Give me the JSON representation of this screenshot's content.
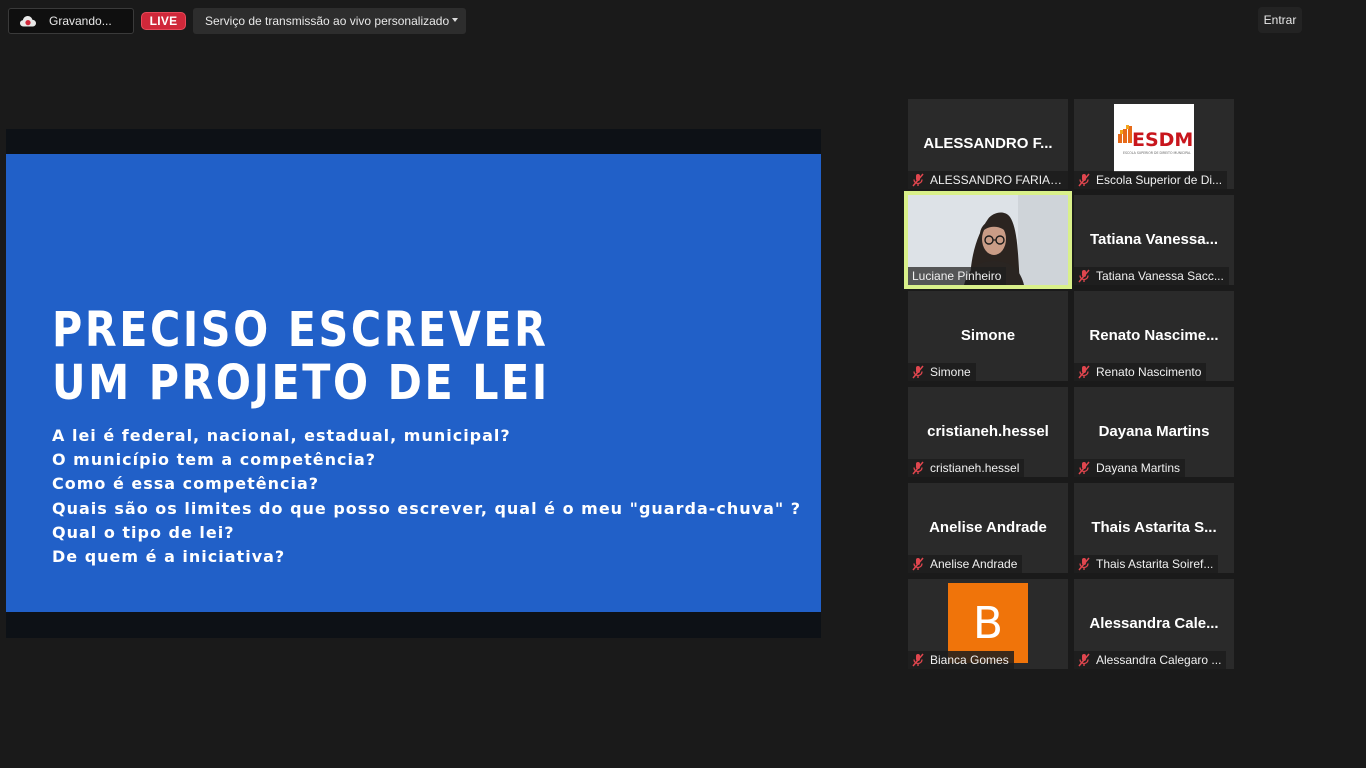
{
  "topbar": {
    "recording_label": "Gravando...",
    "live_label": "LIVE",
    "stream_service_label": "Serviço de transmissão ao vivo personalizado",
    "enter_label": "Entrar"
  },
  "shared_slide": {
    "title_line1": "PRECISO ESCREVER",
    "title_line2": "UM PROJETO DE LEI",
    "questions": [
      "A lei é federal, nacional, estadual, municipal?",
      "O município tem a competência?",
      "Como é essa competência?",
      "Quais são os limites do que posso escrever, qual é o meu \"guarda-chuva\" ?",
      "Qual o tipo de lei?",
      "De quem é a iniciativa?"
    ],
    "background_color": "#2160c8"
  },
  "gallery": [
    {
      "display": "ALESSANDRO F...",
      "name": "ALESSANDRO FARIAS...",
      "muted": true
    },
    {
      "display": "",
      "name": "Escola Superior de Di...",
      "muted": true,
      "logo_text": "ESDM",
      "logo_subtext": "Escola Superior de Direito Municipal"
    },
    {
      "display": "",
      "name": "Luciane Pinheiro",
      "muted": false,
      "active_speaker": true
    },
    {
      "display": "Tatiana  Vanessa...",
      "name": "Tatiana Vanessa Sacc...",
      "muted": true
    },
    {
      "display": "Simone",
      "name": "Simone",
      "muted": true
    },
    {
      "display": "Renato  Nascime...",
      "name": "Renato Nascimento",
      "muted": true
    },
    {
      "display": "cristianeh.hessel",
      "name": "cristianeh.hessel",
      "muted": true
    },
    {
      "display": "Dayana Martins",
      "name": "Dayana Martins",
      "muted": true
    },
    {
      "display": "Anelise Andrade",
      "name": "Anelise Andrade",
      "muted": true
    },
    {
      "display": "Thais  Astarita  S...",
      "name": "Thais Astarita Soiref...",
      "muted": true
    },
    {
      "display": "",
      "name": "Bianca Gomes",
      "muted": true,
      "avatar_letter": "B",
      "avatar_color": "#f0740a"
    },
    {
      "display": "Alessandra  Cale...",
      "name": "Alessandra Calegaro ...",
      "muted": true
    }
  ],
  "colors": {
    "background": "#1a1a1a",
    "tile": "#2a2a2a",
    "live_red": "#d0283a",
    "active_speaker_border": "#d9f08a",
    "mute_icon_red": "#e0464e"
  },
  "icons": {
    "recording": "cloud-record-icon",
    "mute": "microphone-muted-icon",
    "dropdown": "chevron-down-icon"
  }
}
